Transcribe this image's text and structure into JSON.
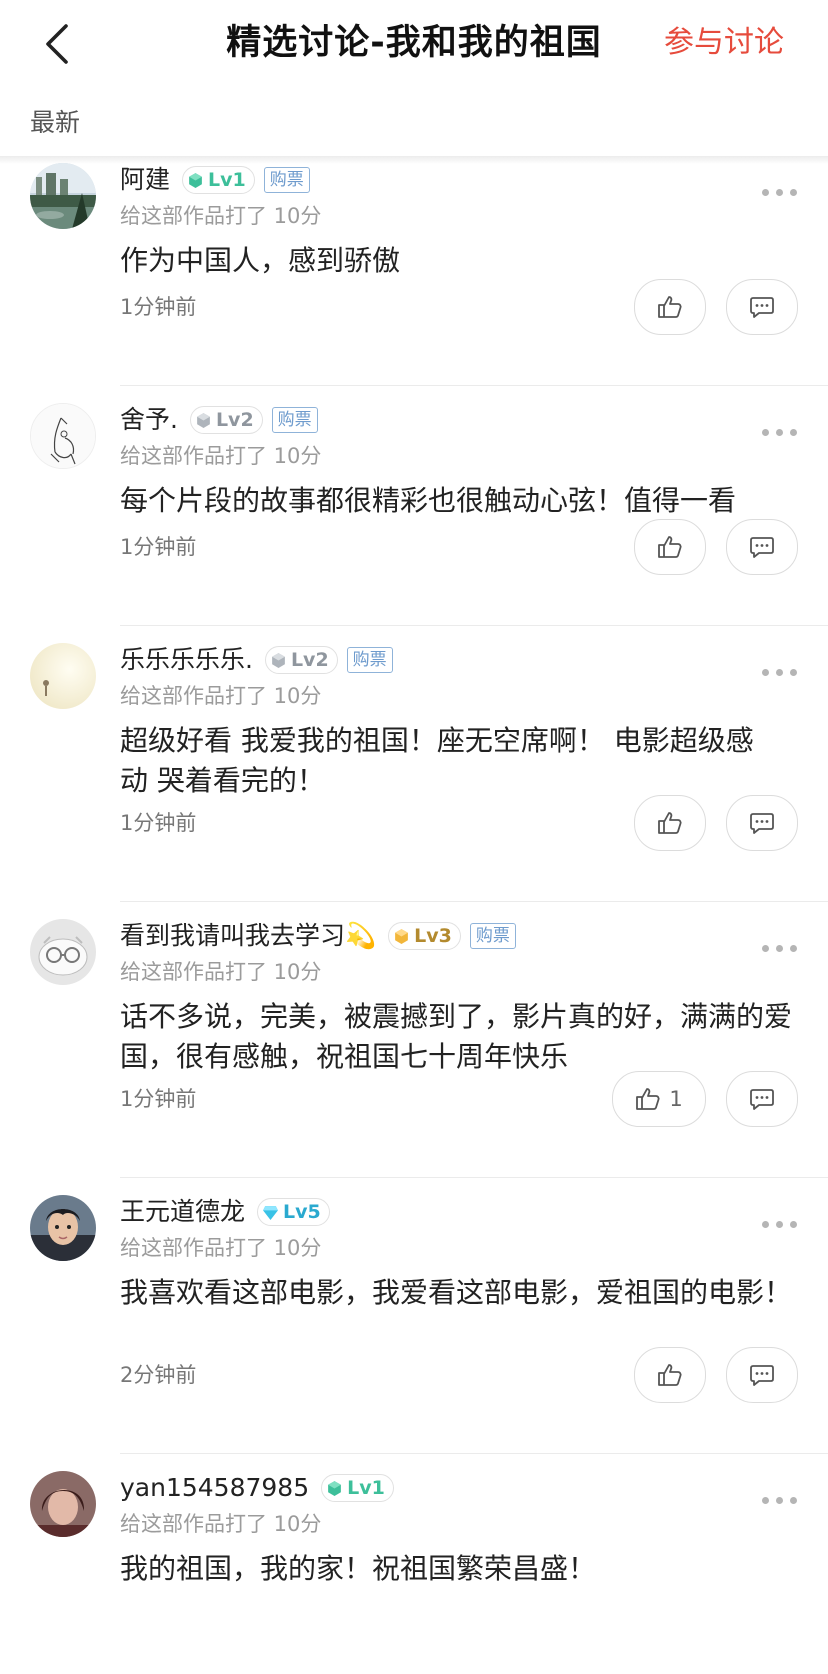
{
  "header": {
    "title": "精选讨论-我和我的祖国",
    "join_label": "参与讨论"
  },
  "sort": {
    "label": "最新"
  },
  "colors": {
    "accent": "#e64b3c",
    "ticket": "#6e9bcd",
    "lv1": "#3dbf9a",
    "lv2": "#9aa0a8",
    "lv3": "#f2b63a",
    "lv5": "#39c2e6"
  },
  "posts": [
    {
      "username": "阿建",
      "level": "Lv1",
      "ticket": "购票",
      "score_text": "给这部作品打了 10分",
      "content": "作为中国人，感到骄傲",
      "time": "1分钟前",
      "likes": ""
    },
    {
      "username": "舍予.",
      "level": "Lv2",
      "ticket": "购票",
      "score_text": "给这部作品打了 10分",
      "content": "每个片段的故事都很精彩也很触动心弦！值得一看",
      "time": "1分钟前",
      "likes": ""
    },
    {
      "username": "乐乐乐乐乐.",
      "level": "Lv2",
      "ticket": "购票",
      "score_text": "给这部作品打了 10分",
      "content": "超级好看 我爱我的祖国！座无空席啊！ 电影超级感动 哭着看完的！",
      "time": "1分钟前",
      "likes": ""
    },
    {
      "username": "看到我请叫我去学习💫",
      "level": "Lv3",
      "ticket": "购票",
      "score_text": "给这部作品打了 10分",
      "content": "话不多说，完美，被震撼到了，影片真的好，满满的爱国，很有感触，祝祖国七十周年快乐",
      "time": "1分钟前",
      "likes": "1"
    },
    {
      "username": "王元道德龙",
      "level": "Lv5",
      "ticket": "",
      "score_text": "给这部作品打了 10分",
      "content": "我喜欢看这部电影，我爱看这部电影，爱祖国的电影！",
      "time": "2分钟前",
      "likes": ""
    },
    {
      "username": "yan154587985",
      "level": "Lv1",
      "ticket": "",
      "score_text": "给这部作品打了 10分",
      "content": "我的祖国，我的家！祝祖国繁荣昌盛！",
      "time": "",
      "likes": ""
    }
  ]
}
